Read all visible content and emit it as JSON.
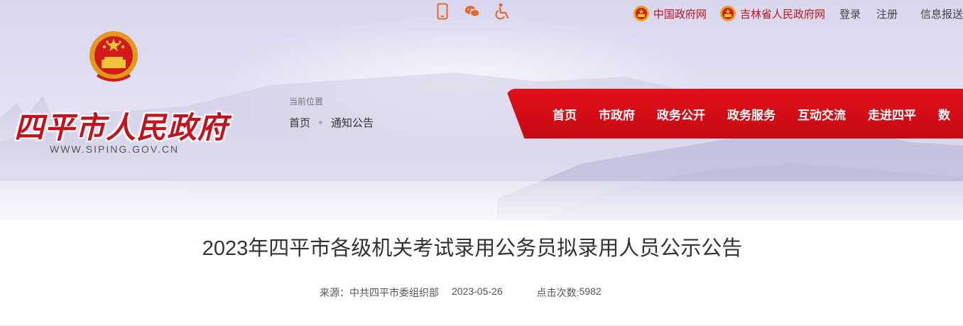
{
  "top_bar": {
    "icons": [
      "mobile-icon",
      "wechat-icon",
      "accessibility-icon"
    ],
    "gov_links": [
      {
        "label": "中国政府网"
      },
      {
        "label": "吉林省人民政府网"
      }
    ],
    "login": "登录",
    "register": "注册",
    "report": "信息报送"
  },
  "logo": {
    "title": "四平市人民政府",
    "url": "WWW.SIPING.GOV.CN"
  },
  "breadcrumb": {
    "label": "当前位置",
    "items": [
      "首页",
      "通知公告"
    ]
  },
  "nav": {
    "items": [
      "首页",
      "市政府",
      "政务公开",
      "政务服务",
      "互动交流",
      "走进四平",
      "数"
    ]
  },
  "article": {
    "title": "2023年四平市各级机关考试录用公务员拟录用人员公示公告",
    "source_label": "来源：",
    "source": "中共四平市委组织部",
    "date": "2023-05-26",
    "hits_label": "点击次数:",
    "hits": "5982"
  },
  "colors": {
    "brand_red": "#c4121c",
    "icon_orange": "#e8652c"
  }
}
